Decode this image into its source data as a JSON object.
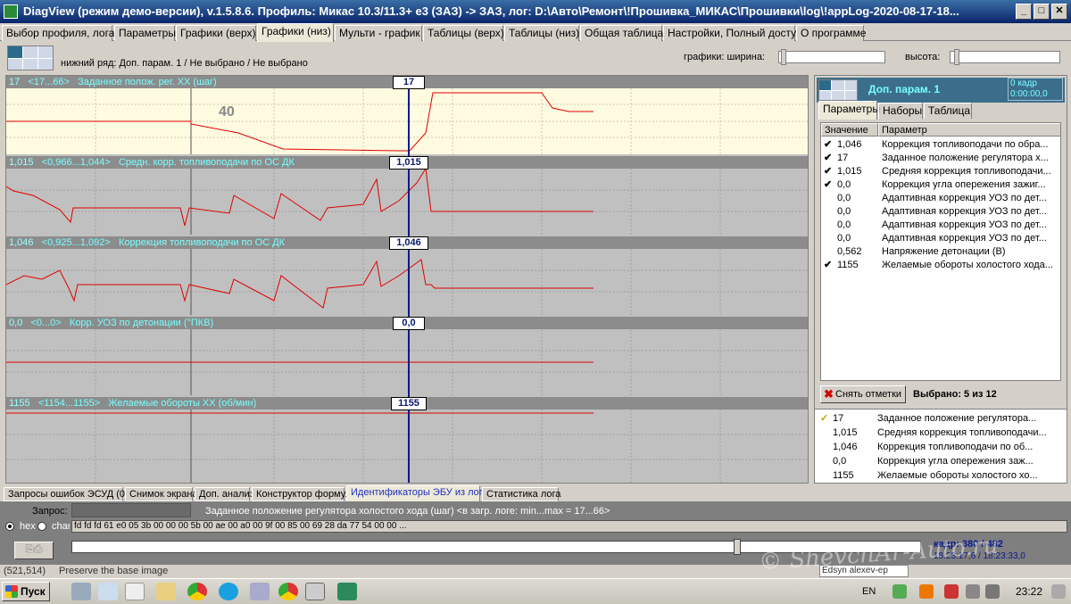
{
  "window": {
    "title": "DiagView (режим демо-версии), v.1.5.8.6. Профиль: Микас 10.3/11.3+ e3 (ЗАЗ) -> ЗАЗ,   лог: D:\\Авто\\Ремонт\\!Прошивка_МИКАС\\Прошивки\\log\\!appLog-2020-08-17-18...",
    "minimize": "_",
    "maximize": "□",
    "close": "✕"
  },
  "tabs": [
    {
      "label": "Выбор профиля, лога"
    },
    {
      "label": "Параметры"
    },
    {
      "label": "Графики (верх)"
    },
    {
      "label": "Графики (низ)"
    },
    {
      "label": "Мульти - график"
    },
    {
      "label": "Таблицы (верх)"
    },
    {
      "label": "Таблицы (низ)"
    },
    {
      "label": "Общая таблица"
    },
    {
      "label": "Настройки, Полный доступ"
    },
    {
      "label": "О программе"
    }
  ],
  "toolbar": {
    "row_label": "нижний ряд: Доп. парам. 1 / Не выбрано / Не выбрано",
    "width_label": "графики:  ширина:",
    "height_label": "высота:"
  },
  "charts": [
    {
      "value": "17",
      "range": "<17...66>",
      "name": "Заданное полож. рег. ХХ (шаг)",
      "cursor": "17",
      "annotation": "40"
    },
    {
      "value": "1,015",
      "range": "<0,966...1,044>",
      "name": "Средн. корр. топливоподачи по ОС ДК",
      "cursor": "1,015"
    },
    {
      "value": "1,046",
      "range": "<0,925...1,092>",
      "name": "Коррекция топливоподачи по ОС ДК",
      "cursor": "1,046"
    },
    {
      "value": "0,0",
      "range": "<0...0>",
      "name": "Корр. УОЗ по детонации (°ПКВ)",
      "cursor": "0,0"
    },
    {
      "value": "1155",
      "range": "<1154...1155>",
      "name": "Желаемые обороты ХХ (об/мин)",
      "cursor": "1155"
    }
  ],
  "right_panel": {
    "title": "Доп. парам. 1",
    "frame_line1": "0 кадр",
    "frame_line2": "0:00:00,0",
    "tabs": [
      "Параметры",
      "Наборы",
      "Таблица"
    ],
    "col_value": "Значение",
    "col_param": "Параметр",
    "rows": [
      {
        "checked": "✔",
        "value": "1,046",
        "name": "Коррекция топливоподачи по обра..."
      },
      {
        "checked": "✔",
        "value": "17",
        "name": "Заданное положение регулятора х..."
      },
      {
        "checked": "✔",
        "value": "1,015",
        "name": "Средняя коррекция топливоподачи..."
      },
      {
        "checked": "✔",
        "value": "0,0",
        "name": "Коррекция угла опережения зажиг..."
      },
      {
        "checked": "",
        "value": "0,0",
        "name": "Адаптивная коррекция УОЗ по дет..."
      },
      {
        "checked": "",
        "value": "0,0",
        "name": "Адаптивная коррекция УОЗ по дет..."
      },
      {
        "checked": "",
        "value": "0,0",
        "name": "Адаптивная коррекция УОЗ по дет..."
      },
      {
        "checked": "",
        "value": "0,0",
        "name": "Адаптивная коррекция УОЗ по дет..."
      },
      {
        "checked": "",
        "value": "0,562",
        "name": "Напряжение детонации (В)"
      },
      {
        "checked": "✔",
        "value": "1155",
        "name": "Желаемые обороты холостого ходa..."
      }
    ],
    "clear_button": "Снять отметки",
    "selected": "Выбрано: 5 из 12",
    "bottom_rows": [
      {
        "checked": "✓",
        "value": "17",
        "name": "Заданное положение регулятора..."
      },
      {
        "checked": "",
        "value": "1,015",
        "name": "Средняя коррекция топливоподачи..."
      },
      {
        "checked": "",
        "value": "1,046",
        "name": "Коррекция топливоподачи по об..."
      },
      {
        "checked": "",
        "value": "0,0",
        "name": "Коррекция угла опережения заж..."
      },
      {
        "checked": "",
        "value": "1155",
        "name": "Желаемые обороты холостого хо..."
      }
    ]
  },
  "bottom_tabs": [
    {
      "label": "Запросы ошибок ЭСУД (0)"
    },
    {
      "label": "Снимок экрана"
    },
    {
      "label": "Доп. анализ"
    },
    {
      "label": "Конструктор формул"
    },
    {
      "label": "Идентификаторы ЭБУ из лога"
    },
    {
      "label": "Статистика лога"
    }
  ],
  "request": {
    "label": "Запрос:",
    "description": "Заданное положение регулятора холостого хода (шаг) <в загр. логе: min...max = 17...66>",
    "hex_label": "hex",
    "char_label": "char",
    "hex_data": "fd fd fd 61 e0 05 3b 00 00 00 5b 00 ae 00 a0 00 9f 00 85 00 69 28 da 77 54 00 00 ..."
  },
  "player": {
    "frame_text": "кадр: 380 / 482",
    "time_text": "18:23:17,6 / 18:23:33,0",
    "position": 0.788
  },
  "status": {
    "coords": "(521,514)",
    "hint": "Preserve the base image",
    "search_box": "Edsyn alexev-ep"
  },
  "taskbar": {
    "start_label": "Пуск",
    "lang": "EN",
    "time": "23:22"
  },
  "watermark": "© ShevchAr-Auto.ru",
  "colors": {
    "trace": "#e00000",
    "cursor": "#0a1a8a",
    "header_text": "#66ffff",
    "panel_head": "#3c6e8c"
  }
}
